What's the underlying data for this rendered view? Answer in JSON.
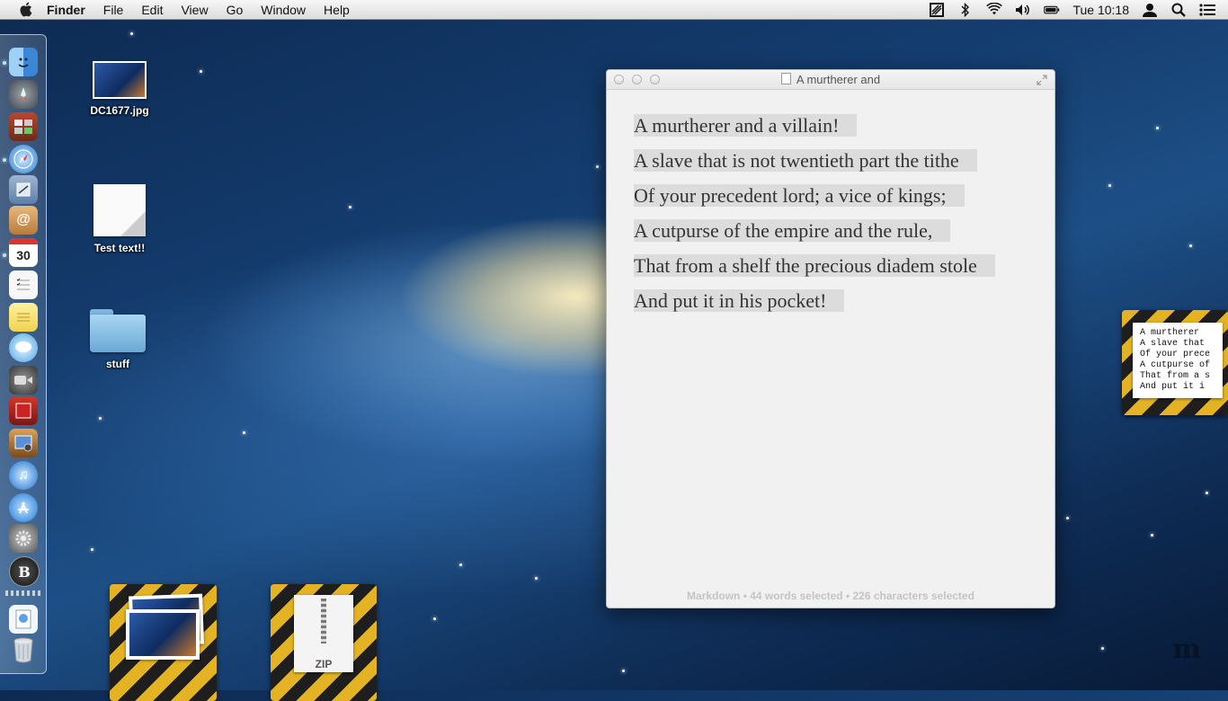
{
  "menubar": {
    "apple_icon": "apple-icon",
    "items": [
      "Finder",
      "File",
      "Edit",
      "View",
      "Go",
      "Window",
      "Help"
    ],
    "clock": "Tue 10:18",
    "status_icons": [
      "display-icon",
      "bluetooth-icon",
      "wifi-icon",
      "volume-icon",
      "battery-icon",
      "user-icon",
      "spotlight-icon",
      "notification-icon"
    ]
  },
  "dock": {
    "apps": [
      "finder",
      "launchpad",
      "photo-booth",
      "safari",
      "mail-stamp",
      "contacts",
      "calendar",
      "reminders",
      "notes",
      "messages",
      "facetime",
      "photo-viewer",
      "iphoto",
      "itunes",
      "app-store",
      "system-preferences",
      "bbedit",
      "downloads",
      "trash"
    ],
    "calendar_day": "30",
    "bbedit_letter": "B"
  },
  "desktop": {
    "icons": [
      {
        "label": "DC1677.jpg"
      },
      {
        "label": "Test text!!"
      },
      {
        "label": "stuff"
      }
    ],
    "zip_label": "ZIP",
    "note_lines": [
      "A murtherer",
      "A slave that",
      "Of your prece",
      "A cutpurse of",
      "That from a s",
      "And put it i"
    ]
  },
  "window": {
    "title": "A murtherer and",
    "lines": [
      "A murtherer and a villain!",
      "A slave that is not twentieth part the tithe",
      "Of your precedent lord; a vice of kings;",
      "A cutpurse of the empire and the rule,",
      "That from a shelf the precious diadem stole",
      "And put it in his pocket!"
    ],
    "status": "Markdown • 44 words selected • 226 characters selected"
  },
  "watermark": "m"
}
